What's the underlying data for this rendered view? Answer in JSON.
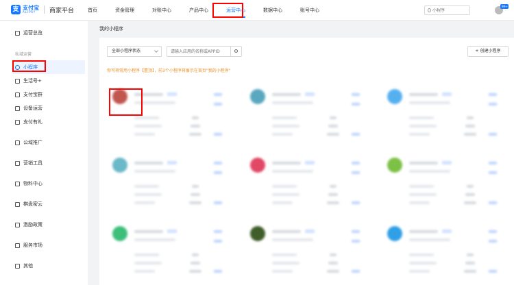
{
  "brand": {
    "name": "支付宝",
    "name_en": "ALIPAY",
    "platform": "商家平台",
    "color": "#1677ff"
  },
  "nav": {
    "items": [
      {
        "label": "首页"
      },
      {
        "label": "资金管理"
      },
      {
        "label": "对账中心"
      },
      {
        "label": "产品中心"
      },
      {
        "label": "运营中心",
        "active": true
      },
      {
        "label": "数据中心"
      },
      {
        "label": "账号中心"
      }
    ],
    "search_placeholder": "小程序",
    "notification_badge": "99+"
  },
  "sidebar": {
    "overview": "运营总览",
    "group_label": "私域运营",
    "items": [
      {
        "label": "小程序",
        "icon": "mini-program-icon",
        "active": true
      },
      {
        "label": "生活号+",
        "icon": "life-account-icon"
      },
      {
        "label": "支付宝群",
        "icon": "group-icon"
      },
      {
        "label": "设备运营",
        "icon": "device-icon"
      },
      {
        "label": "支付有礼",
        "icon": "gift-icon"
      }
    ],
    "sections": [
      {
        "label": "公域推广",
        "icon": "promotion-icon"
      },
      {
        "label": "营销工具",
        "icon": "marketing-icon"
      },
      {
        "label": "物料中心",
        "icon": "material-icon"
      },
      {
        "label": "棋盘密云",
        "icon": "cloud-icon"
      },
      {
        "label": "激励政策",
        "icon": "incentive-icon"
      },
      {
        "label": "服务市场",
        "icon": "market-icon"
      },
      {
        "label": "其他",
        "icon": "other-icon"
      }
    ]
  },
  "main": {
    "breadcrumb": "我的小程序",
    "status_filter": "全部小程序状态",
    "search_placeholder": "请输入应用的名称或APPID",
    "create_label": "+ 创建小程序",
    "notice": "你可将常用小程序【置顶】，前3个小程序将展示在首页\"我的小程序\""
  },
  "cards": [
    {
      "icon_color": "#c0564e"
    },
    {
      "icon_color": "#5aa7c0"
    },
    {
      "icon_color": "#56b0f0"
    },
    {
      "icon_color": "#6ab8c8"
    },
    {
      "icon_color": "#e04865"
    },
    {
      "icon_color": "#7cc046"
    },
    {
      "icon_color": "#3dbf7a"
    },
    {
      "icon_color": "#3f5e2a"
    },
    {
      "icon_color": "#2f9fe6"
    }
  ]
}
